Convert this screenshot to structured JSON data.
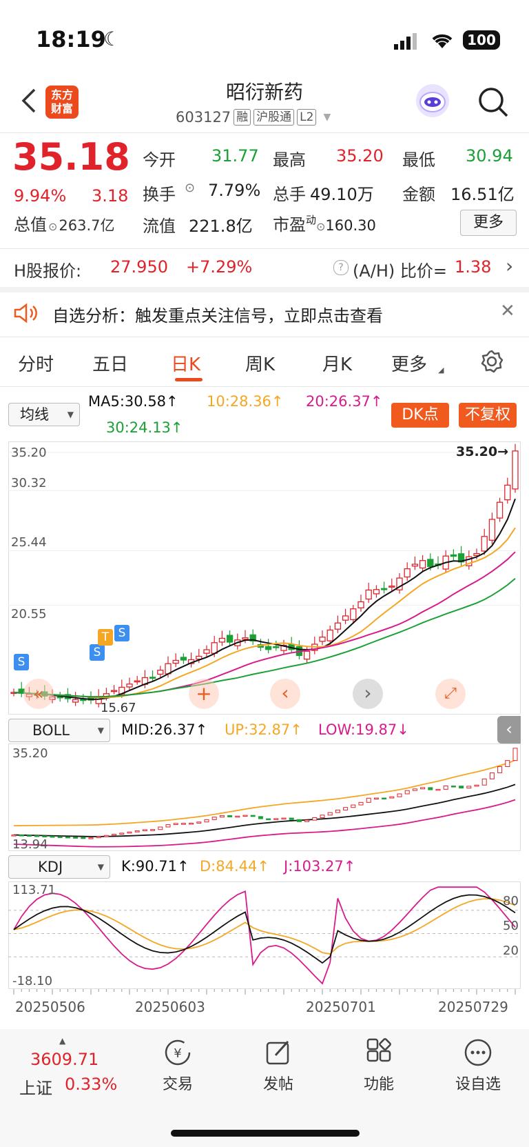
{
  "status": {
    "time": "18:19",
    "battery": "100"
  },
  "header": {
    "title": "昭衍新药",
    "code": "603127",
    "tags": [
      "融",
      "沪股通",
      "L2"
    ],
    "logo_text_1": "东方",
    "logo_text_2": "财富"
  },
  "quote": {
    "price": "35.18",
    "change_pct": "9.94%",
    "change": "3.18",
    "open_label": "今开",
    "open": "31.77",
    "high_label": "最高",
    "high": "35.20",
    "low_label": "最低",
    "low": "30.94",
    "turnover_label": "换手",
    "turnover": "7.79%",
    "volume_label": "总手",
    "volume": "49.10万",
    "amount_label": "金额",
    "amount": "16.51亿",
    "mcap_label": "总值",
    "mcap": "263.7亿",
    "float_label": "流值",
    "float": "221.8亿",
    "pe_label": "市盈",
    "pe_sup": "动",
    "pe": "160.30",
    "more": "更多"
  },
  "hshare": {
    "label": "H股报价:",
    "price": "27.950",
    "pct": "+7.29%",
    "ratio_label": "(A/H) 比价=",
    "ratio": "1.38"
  },
  "notice": {
    "text": "自选分析：触发重点关注信号，立即点击查看"
  },
  "tabs": [
    "分时",
    "五日",
    "日K",
    "周K",
    "月K",
    "更多"
  ],
  "active_tab": 2,
  "ma": {
    "selector": "均线",
    "ma5": "MA5:30.58↑",
    "ma10": "10:28.36↑",
    "ma20": "20:26.37↑",
    "ma30": "30:24.13↑",
    "dk": "DK点",
    "fq": "不复权"
  },
  "kline": {
    "y_labels": [
      "35.20",
      "30.32",
      "25.44",
      "20.55"
    ],
    "max_label": "35.20→",
    "low_label": "15.67",
    "signals": [
      "S",
      "S",
      "T",
      "S"
    ]
  },
  "boll": {
    "selector": "BOLL",
    "mid": "MID:26.37↑",
    "up": "UP:32.87↑",
    "low": "LOW:19.87↓",
    "top": "35.20",
    "bottom": "13.94"
  },
  "kdj": {
    "selector": "KDJ",
    "k": "K:90.71↑",
    "d": "D:84.44↑",
    "j": "J:103.27↑",
    "top": "113.71",
    "bottom": "-18.10",
    "levels": [
      "80",
      "50",
      "20"
    ]
  },
  "dates": [
    "20250506",
    "20250603",
    "20250701",
    "20250729"
  ],
  "colors": {
    "up": "#e0232b",
    "down": "#1aa034",
    "ma5": "#111111",
    "ma10": "#f5a623",
    "ma20": "#d81b8c",
    "ma30": "#1aa034"
  },
  "bottom": {
    "index_value": "3609.71",
    "index_name": "上证",
    "index_pct": "0.33%",
    "nav": [
      "交易",
      "发帖",
      "功能",
      "设自选"
    ]
  }
}
